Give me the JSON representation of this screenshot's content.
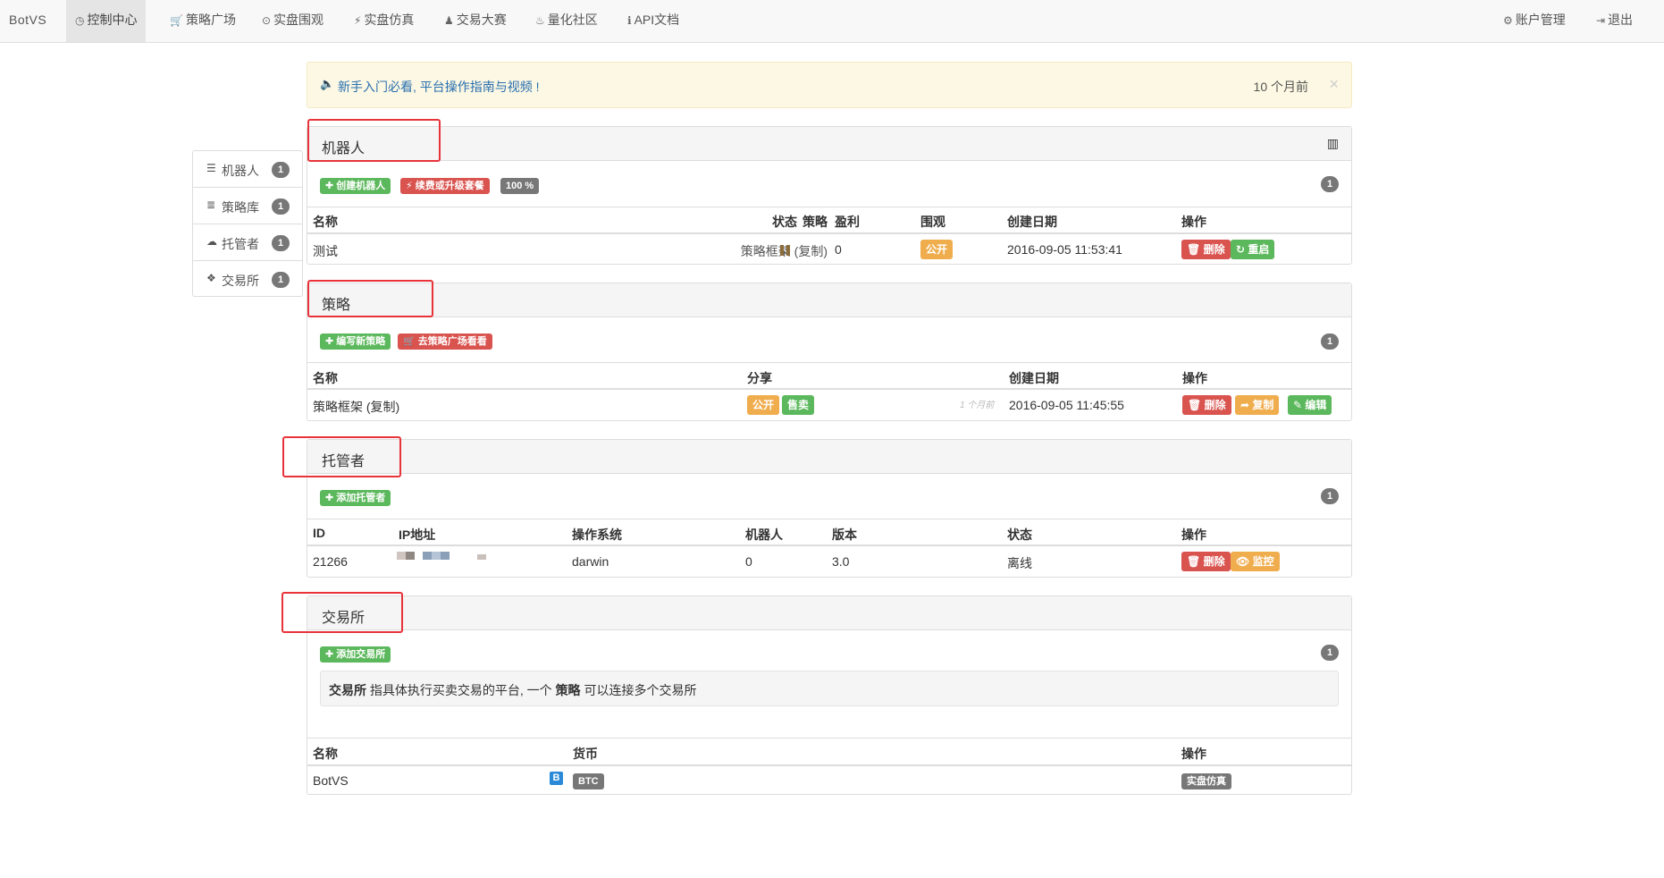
{
  "nav": {
    "brand": "BotVS",
    "items": [
      {
        "label": "控制中心",
        "icon": "clock-icon",
        "glyph": "◷",
        "active": true
      },
      {
        "label": "策略广场",
        "icon": "cart-icon",
        "glyph": "🛒"
      },
      {
        "label": "实盘围观",
        "icon": "play-circle-icon",
        "glyph": "⊙"
      },
      {
        "label": "实盘仿真",
        "icon": "bolt-icon",
        "glyph": "⚡"
      },
      {
        "label": "交易大赛",
        "icon": "user-icon",
        "glyph": "♟"
      },
      {
        "label": "量化社区",
        "icon": "fire-icon",
        "glyph": "♨"
      },
      {
        "label": "API文档",
        "icon": "info-icon",
        "glyph": "ℹ"
      }
    ],
    "account": {
      "label": "账户管理",
      "glyph": "⚙"
    },
    "logout": {
      "label": "退出",
      "glyph": "⇥"
    }
  },
  "notice": {
    "text": "新手入门必看, 平台操作指南与视频 !",
    "time": "10 个月前",
    "close": "×",
    "glyph": "🔈"
  },
  "sidebar": [
    {
      "label": "机器人",
      "count": "1",
      "icon": "server-icon",
      "glyph": "☰"
    },
    {
      "label": "策略库",
      "count": "1",
      "icon": "database-icon",
      "glyph": "≣"
    },
    {
      "label": "托管者",
      "count": "1",
      "icon": "cloud-icon",
      "glyph": "☁"
    },
    {
      "label": "交易所",
      "count": "1",
      "icon": "cubes-icon",
      "glyph": "❖"
    }
  ],
  "robots": {
    "title": "机器人",
    "chart_glyph": "▥",
    "buttons": {
      "create": "✚ 创建机器人",
      "renew": "⚡ 续费或升级套餐",
      "percent": "100 %"
    },
    "count": "1",
    "headers": {
      "name": "名称",
      "strategy": "策略",
      "status": "状态",
      "profit": "盈利",
      "watch": "围观",
      "created": "创建日期",
      "actions": "操作"
    },
    "rows": [
      {
        "name": "测试",
        "strategy": "策略框架 (复制)",
        "profit": "0",
        "watch": "公开",
        "created": "2016-09-05 11:53:41",
        "delete": "🗑 删除",
        "restart": "↻ 重启"
      }
    ]
  },
  "strategies": {
    "title": "策略",
    "buttons": {
      "write": "✚ 编写新策略",
      "go": "🛒 去策略广场看看"
    },
    "count": "1",
    "headers": {
      "name": "名称",
      "share": "分享",
      "created": "创建日期",
      "actions": "操作"
    },
    "rows": [
      {
        "name": "策略框架 (复制)",
        "public": "公开",
        "sell": "售卖",
        "ago": "1 个月前",
        "created": "2016-09-05 11:45:55",
        "delete": "🗑 删除",
        "copy": "➦ 复制",
        "edit": "✎ 编辑"
      }
    ]
  },
  "hosts": {
    "title": "托管者",
    "buttons": {
      "add": "✚ 添加托管者"
    },
    "count": "1",
    "headers": {
      "id": "ID",
      "ip": "IP地址",
      "os": "操作系统",
      "robots": "机器人",
      "version": "版本",
      "status": "状态",
      "actions": "操作"
    },
    "rows": [
      {
        "id": "21266",
        "os": "darwin",
        "robots": "0",
        "version": "3.0",
        "status": "离线",
        "delete": "🗑 删除",
        "monitor": "👁 监控"
      }
    ]
  },
  "exchanges": {
    "title": "交易所",
    "buttons": {
      "add": "✚ 添加交易所"
    },
    "count": "1",
    "info": {
      "term": "交易所",
      "text1": " 指具体执行买卖交易的平台, 一个 ",
      "term2": "策略",
      "text2": " 可以连接多个交易所"
    },
    "headers": {
      "name": "名称",
      "currency": "货币",
      "actions": "操作"
    },
    "rows": [
      {
        "name": "BotVS",
        "b_icon": "B",
        "currency": "BTC",
        "action": "实盘仿真"
      }
    ]
  },
  "colors": {
    "green": "#5cb85c",
    "red": "#d9534f",
    "orange": "#f0ad4e",
    "gray": "#777777",
    "link": "#2a6fb0",
    "highlight": "#e8333a"
  }
}
